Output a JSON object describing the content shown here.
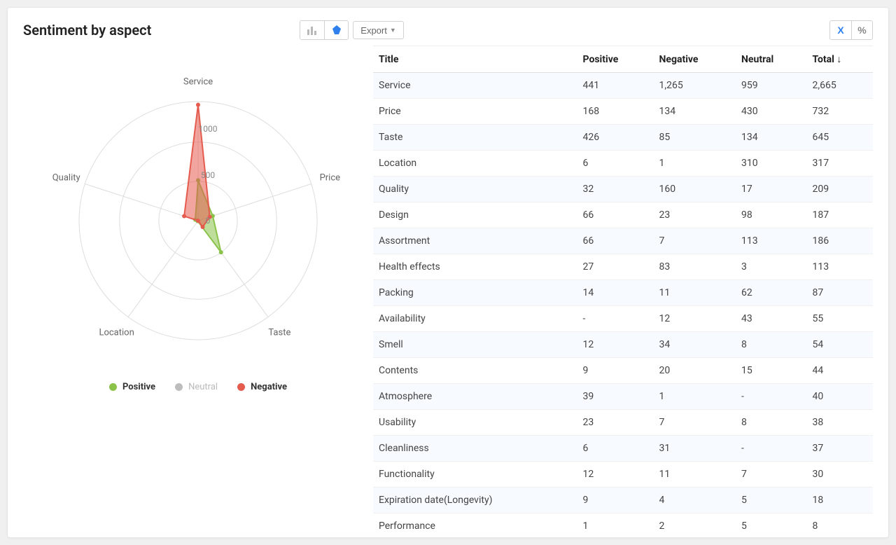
{
  "title": "Sentiment by aspect",
  "toolbar": {
    "export_label": "Export",
    "close_label": "X",
    "percent_label": "%"
  },
  "legend": {
    "positive": "Positive",
    "neutral": "Neutral",
    "negative": "Negative"
  },
  "colors": {
    "positive": "#8bc34a",
    "neutral": "#bdbdbd",
    "negative": "#e55b4e"
  },
  "table": {
    "headers": {
      "title": "Title",
      "positive": "Positive",
      "negative": "Negative",
      "neutral": "Neutral",
      "total": "Total ↓"
    },
    "rows": [
      {
        "title": "Service",
        "positive": "441",
        "negative": "1,265",
        "neutral": "959",
        "total": "2,665"
      },
      {
        "title": "Price",
        "positive": "168",
        "negative": "134",
        "neutral": "430",
        "total": "732"
      },
      {
        "title": "Taste",
        "positive": "426",
        "negative": "85",
        "neutral": "134",
        "total": "645"
      },
      {
        "title": "Location",
        "positive": "6",
        "negative": "1",
        "neutral": "310",
        "total": "317"
      },
      {
        "title": "Quality",
        "positive": "32",
        "negative": "160",
        "neutral": "17",
        "total": "209"
      },
      {
        "title": "Design",
        "positive": "66",
        "negative": "23",
        "neutral": "98",
        "total": "187"
      },
      {
        "title": "Assortment",
        "positive": "66",
        "negative": "7",
        "neutral": "113",
        "total": "186"
      },
      {
        "title": "Health effects",
        "positive": "27",
        "negative": "83",
        "neutral": "3",
        "total": "113"
      },
      {
        "title": "Packing",
        "positive": "14",
        "negative": "11",
        "neutral": "62",
        "total": "87"
      },
      {
        "title": "Availability",
        "positive": "-",
        "negative": "12",
        "neutral": "43",
        "total": "55"
      },
      {
        "title": "Smell",
        "positive": "12",
        "negative": "34",
        "neutral": "8",
        "total": "54"
      },
      {
        "title": "Contents",
        "positive": "9",
        "negative": "20",
        "neutral": "15",
        "total": "44"
      },
      {
        "title": "Atmosphere",
        "positive": "39",
        "negative": "1",
        "neutral": "-",
        "total": "40"
      },
      {
        "title": "Usability",
        "positive": "23",
        "negative": "7",
        "neutral": "8",
        "total": "38"
      },
      {
        "title": "Cleanliness",
        "positive": "6",
        "negative": "31",
        "neutral": "-",
        "total": "37"
      },
      {
        "title": "Functionality",
        "positive": "12",
        "negative": "11",
        "neutral": "7",
        "total": "30"
      },
      {
        "title": "Expiration date(Longevity)",
        "positive": "9",
        "negative": "4",
        "neutral": "5",
        "total": "18"
      },
      {
        "title": "Performance",
        "positive": "1",
        "negative": "2",
        "neutral": "5",
        "total": "8"
      }
    ]
  },
  "chart_data": {
    "type": "radar",
    "title": "Sentiment by aspect",
    "categories": [
      "Service",
      "Price",
      "Taste",
      "Location",
      "Quality"
    ],
    "ticks": [
      0,
      500,
      1000
    ],
    "max": 1300,
    "series": [
      {
        "name": "Positive",
        "color": "#8bc34a",
        "values": [
          441,
          168,
          426,
          6,
          32
        ]
      },
      {
        "name": "Negative",
        "color": "#e55b4e",
        "values": [
          1265,
          134,
          85,
          1,
          160
        ]
      }
    ]
  }
}
